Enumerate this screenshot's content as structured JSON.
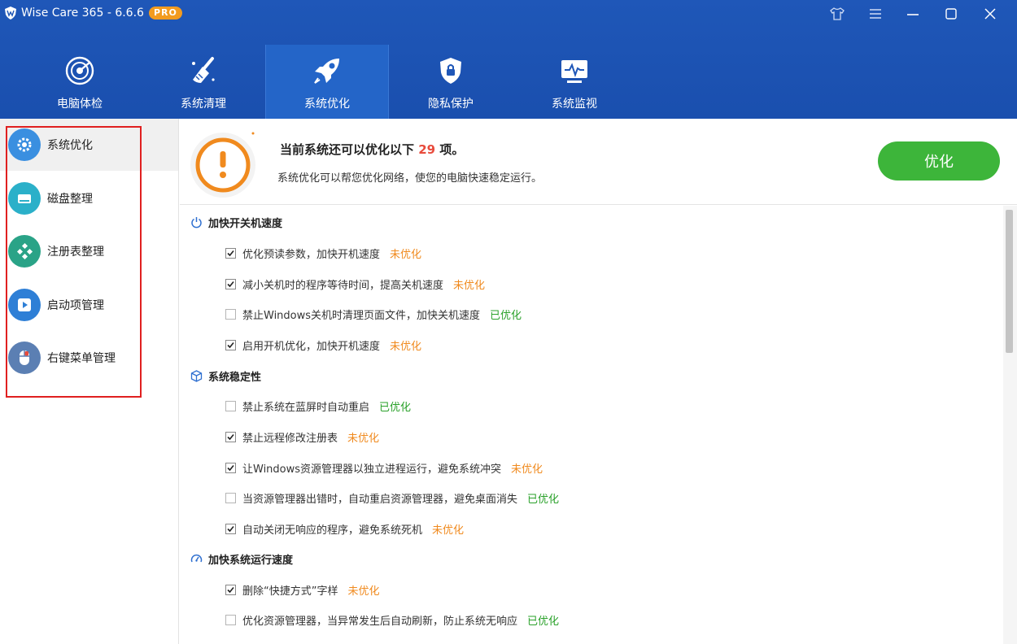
{
  "app": {
    "title": "Wise Care 365 - 6.6.6",
    "badge": "PRO"
  },
  "window_controls": [
    "skin-icon",
    "menu-icon",
    "minimize-icon",
    "maximize-icon",
    "close-icon"
  ],
  "tabs": [
    {
      "label": "电脑体检",
      "icon": "radar-icon"
    },
    {
      "label": "系统清理",
      "icon": "broom-icon"
    },
    {
      "label": "系统优化",
      "icon": "rocket-icon",
      "active": true
    },
    {
      "label": "隐私保护",
      "icon": "shield-lock-icon"
    },
    {
      "label": "系统监视",
      "icon": "monitor-pulse-icon"
    }
  ],
  "sidebar": {
    "items": [
      {
        "label": "系统优化",
        "icon": "gear-icon",
        "color": "#3a8fe0",
        "active": true
      },
      {
        "label": "磁盘整理",
        "icon": "disk-icon",
        "color": "#2bb0c9"
      },
      {
        "label": "注册表整理",
        "icon": "registry-icon",
        "color": "#2aa387"
      },
      {
        "label": "启动项管理",
        "icon": "play-icon",
        "color": "#2e7fd6"
      },
      {
        "label": "右键菜单管理",
        "icon": "mouse-icon",
        "color": "#5b7fb3"
      }
    ]
  },
  "summary": {
    "title_prefix": "当前系统还可以优化以下 ",
    "count": "29",
    "title_suffix": " 项。",
    "description": "系统优化可以帮您优化网络，使您的电脑快速稳定运行。",
    "button": "优化"
  },
  "sections": [
    {
      "title": "加快开关机速度",
      "icon": "power-icon",
      "items": [
        {
          "text": "优化预读参数，加快开机速度",
          "checked": true,
          "status": "未优化"
        },
        {
          "text": "减小关机时的程序等待时间，提高关机速度",
          "checked": true,
          "status": "未优化"
        },
        {
          "text": "禁止Windows关机时清理页面文件，加快关机速度",
          "checked": false,
          "status": "已优化"
        },
        {
          "text": "启用开机优化，加快开机速度",
          "checked": true,
          "status": "未优化"
        }
      ]
    },
    {
      "title": "系统稳定性",
      "icon": "cube-icon",
      "items": [
        {
          "text": "禁止系统在蓝屏时自动重启",
          "checked": false,
          "status": "已优化"
        },
        {
          "text": "禁止远程修改注册表",
          "checked": true,
          "status": "未优化"
        },
        {
          "text": "让Windows资源管理器以独立进程运行，避免系统冲突",
          "checked": true,
          "status": "未优化"
        },
        {
          "text": "当资源管理器出错时，自动重启资源管理器，避免桌面消失",
          "checked": false,
          "status": "已优化"
        },
        {
          "text": "自动关闭无响应的程序，避免系统死机",
          "checked": true,
          "status": "未优化"
        }
      ]
    },
    {
      "title": "加快系统运行速度",
      "icon": "speedometer-icon",
      "items": [
        {
          "text": "删除“快捷方式”字样",
          "checked": true,
          "status": "未优化"
        },
        {
          "text": "优化资源管理器，当异常发生后自动刷新，防止系统无响应",
          "checked": false,
          "status": "已优化"
        }
      ]
    }
  ],
  "colors": {
    "header": "#1f57b8",
    "pending": "#f08a1e",
    "done": "#2aa12a",
    "button": "#3db53a",
    "count": "#e84b3c",
    "highlight": "#e02020"
  }
}
